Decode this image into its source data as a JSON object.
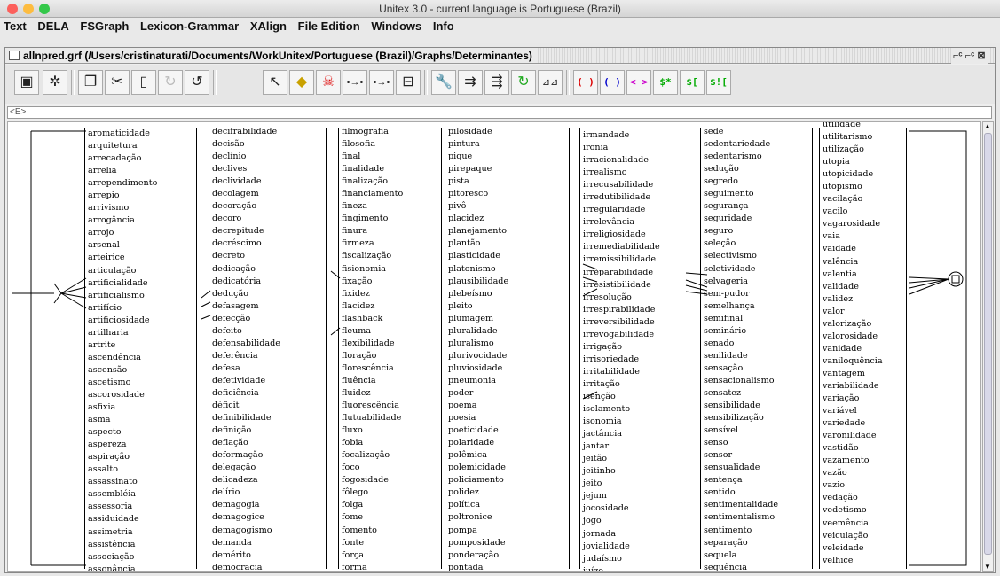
{
  "window": {
    "title": "Unitex 3.0 - current language is Portuguese (Brazil)"
  },
  "menu": [
    "Text",
    "DELA",
    "FSGraph",
    "Lexicon-Grammar",
    "XAlign",
    "File Edition",
    "Windows",
    "Info"
  ],
  "frame": {
    "title": "allnpred.grf (/Users/cristinaturati/Documents/WorkUnitex/Portuguese (Brazil)/Graphs/Determinantes)",
    "controls": "⌐ᶜ ⌐ᶜ ⊠"
  },
  "toolbar": {
    "b_paren": "( )",
    "b_paren2": "( )",
    "b_angle": "< >",
    "b_dollar_star": "$*",
    "b_dollar_brk": "$[",
    "b_dollar_not": "$!["
  },
  "boxbar": {
    "value": "<E>"
  },
  "columns": [
    [
      "aromaticidade",
      "arquitetura",
      "arrecadação",
      "arrelia",
      "arrependimento",
      "arrepio",
      "arrivismo",
      "arrogância",
      "arrojo",
      "arsenal",
      "arteirice",
      "articulação",
      "artificialidade",
      "artificialismo",
      "artifício",
      "artificiosidade",
      "artilharia",
      "artrite",
      "ascendência",
      "ascensão",
      "ascetismo",
      "ascorosidade",
      "asfixia",
      "asma",
      "aspecto",
      "aspereza",
      "aspiração",
      "assalto",
      "assassinato",
      "assembléia",
      "assessoria",
      "assiduidade",
      "assimetria",
      "assistência",
      "associação",
      "assonância"
    ],
    [
      "decifrabilidade",
      "decisão",
      "declínio",
      "declives",
      "declividade",
      "decolagem",
      "decoração",
      "decoro",
      "decrepitude",
      "decréscimo",
      "decreto",
      "dedicação",
      "dedicatória",
      "dedução",
      "defasagem",
      "defecção",
      "defeito",
      "defensabilidade",
      "deferência",
      "defesa",
      "defetividade",
      "deficiência",
      "déficit",
      "definibilidade",
      "definição",
      "deflação",
      "deformação",
      "delegação",
      "delicadeza",
      "delírio",
      "demagogia",
      "demagogice",
      "demagogismo",
      "demanda",
      "demérito",
      "democracia"
    ],
    [
      "filmografia",
      "filosofia",
      "final",
      "finalidade",
      "finalização",
      "financiamento",
      "fineza",
      "fingimento",
      "finura",
      "firmeza",
      "fiscalização",
      "fisionomia",
      "fixação",
      "fixidez",
      "flacidez",
      "flashback",
      "fleuma",
      "flexibilidade",
      "floração",
      "florescência",
      "fluência",
      "fluidez",
      "fluorescência",
      "flutuabilidade",
      "fluxo",
      "fobia",
      "focalização",
      "foco",
      "fogosidade",
      "fôlego",
      "folga",
      "fome",
      "fomento",
      "fonte",
      "força",
      "forma"
    ],
    [
      "pilosidade",
      "pintura",
      "pique",
      "pirepaque",
      "pista",
      "pitoresco",
      "pivô",
      "placidez",
      "planejamento",
      "plantão",
      "plasticidade",
      "platonismo",
      "plausibilidade",
      "plebeísmo",
      "pleito",
      "plumagem",
      "pluralidade",
      "pluralismo",
      "plurivocidade",
      "pluviosidade",
      "pneumonia",
      "poder",
      "poema",
      "poesia",
      "poeticidade",
      "polaridade",
      "polêmica",
      "polemicidade",
      "policiamento",
      "polidez",
      "política",
      "poltronice",
      "pompa",
      "pomposidade",
      "ponderação",
      "pontada"
    ],
    [
      "irmandade",
      "ironia",
      "irracionalidade",
      "irrealismo",
      "irrecusabilidade",
      "irredutibilidade",
      "irregularidade",
      "irrelevância",
      "irreligiosidade",
      "irremediabilidade",
      "irremissibilidade",
      "irreparabilidade",
      "irresistibilidade",
      "irresolução",
      "irrespirabilidade",
      "irreversibilidade",
      "irrevogabilidade",
      "irrigação",
      "irrisoriedade",
      "irritabilidade",
      "irritação",
      "isenção",
      "isolamento",
      "isonomia",
      "jactância",
      "jantar",
      "jeitão",
      "jeitinho",
      "jeito",
      "jejum",
      "jocosidade",
      "jogo",
      "jornada",
      "jovialidade",
      "judaísmo",
      "juízo"
    ],
    [
      "sede",
      "sedentariedade",
      "sedentarismo",
      "sedução",
      "segredo",
      "seguimento",
      "segurança",
      "seguridade",
      "seguro",
      "seleção",
      "selectivismo",
      "seletividade",
      "selvageria",
      "sem-pudor",
      "semelhança",
      "semifinal",
      "seminário",
      "senado",
      "senilidade",
      "sensação",
      "sensacionalismo",
      "sensatez",
      "sensibilidade",
      "sensibilização",
      "sensível",
      "senso",
      "sensor",
      "sensualidade",
      "sentença",
      "sentido",
      "sentimentalidade",
      "sentimentalismo",
      "sentimento",
      "separação",
      "sequela",
      "sequência"
    ],
    [
      "utilidade",
      "utilitarismo",
      "utilização",
      "utopia",
      "utopicidade",
      "utopismo",
      "vacilação",
      "vacilo",
      "vagarosidade",
      "vaia",
      "vaidade",
      "valência",
      "valentia",
      "validade",
      "validez",
      "valor",
      "valorização",
      "valorosidade",
      "vanidade",
      "vaniloquência",
      "vantagem",
      "variabilidade",
      "variação",
      "variável",
      "variedade",
      "varonilidade",
      "vastidão",
      "vazamento",
      "vazão",
      "vazio",
      "vedação",
      "vedetismo",
      "veemência",
      "veiculação",
      "veleidade",
      "velhice"
    ]
  ]
}
